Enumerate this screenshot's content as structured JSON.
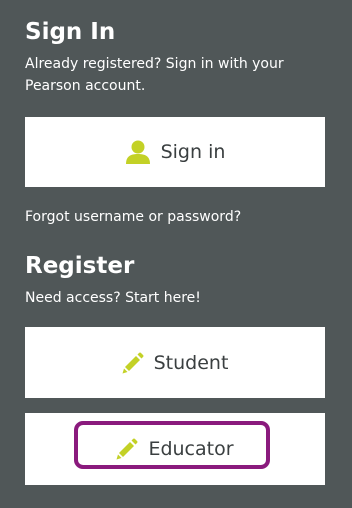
{
  "sign_in_section": {
    "heading": "Sign In",
    "description_line1": "Already registered? Sign in with your",
    "description_line2": "Pearson account.",
    "button_label": "Sign in",
    "forgot_link": "Forgot username or password?"
  },
  "register_section": {
    "heading": "Register",
    "description": "Need access? Start here!",
    "student_label": "Student",
    "educator_label": "Educator"
  },
  "colors": {
    "background": "#505758",
    "icon_accent": "#c3d126",
    "highlight": "#8a1a7d"
  },
  "icons": {
    "sign_in": "user-icon",
    "student": "pencil-icon",
    "educator": "pencil-icon"
  }
}
